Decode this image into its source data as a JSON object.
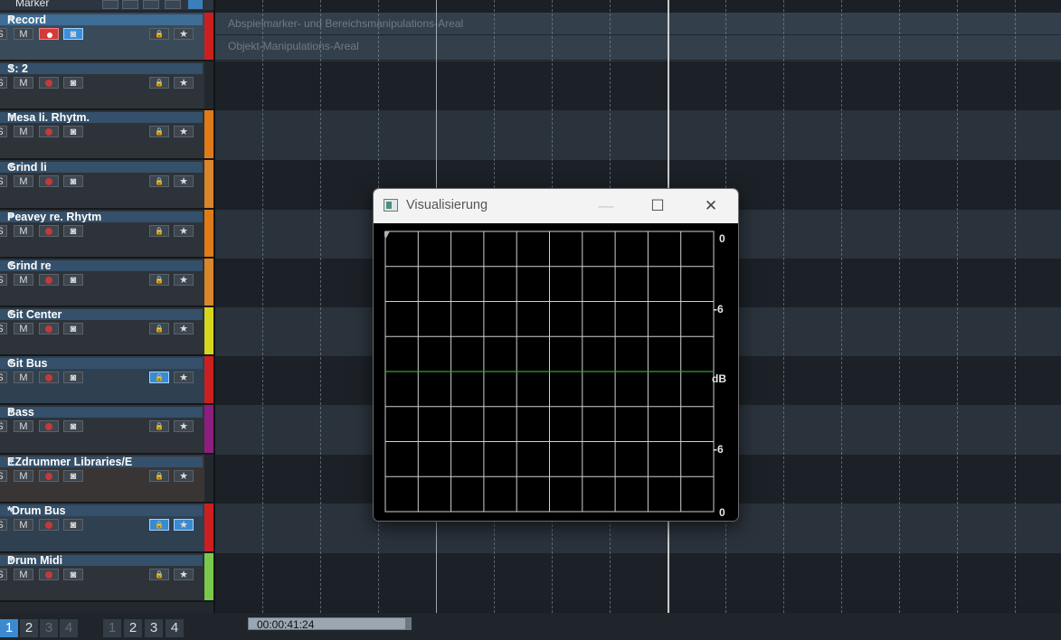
{
  "marker_header": {
    "label": "Marker"
  },
  "tracks": [
    {
      "name": "Record",
      "selected": true,
      "color": "#cc1f1f",
      "lock_on": false,
      "star_on": false
    },
    {
      "name": "S: 2",
      "selected": false,
      "color": "",
      "lock_on": false,
      "star_on": false
    },
    {
      "name": "Mesa li. Rhytm.",
      "selected": false,
      "color": "#e07b18",
      "lock_on": false,
      "star_on": false
    },
    {
      "name": "Grind li",
      "selected": false,
      "color": "#d9852a",
      "lock_on": false,
      "star_on": false
    },
    {
      "name": "Peavey re. Rhytm",
      "selected": false,
      "color": "#e07b18",
      "lock_on": false,
      "star_on": false
    },
    {
      "name": "Grind re",
      "selected": false,
      "color": "#d9852a",
      "lock_on": false,
      "star_on": false
    },
    {
      "name": "Git Center",
      "selected": false,
      "color": "#d6d61e",
      "lock_on": false,
      "star_on": false
    },
    {
      "name": "Git Bus",
      "selected": false,
      "color": "#cc1f1f",
      "lock_on": true,
      "star_on": false
    },
    {
      "name": "Bass",
      "selected": false,
      "color": "#8e1e7e",
      "lock_on": false,
      "star_on": false
    },
    {
      "name": "EZdrummer Libraries/E",
      "selected": false,
      "color": "",
      "lock_on": false,
      "star_on": false
    },
    {
      "name": "*Drum Bus",
      "selected": false,
      "color": "#cc1f1f",
      "lock_on": true,
      "star_on": true
    },
    {
      "name": "Drum Midi",
      "selected": false,
      "color": "#7ac94a",
      "lock_on": false,
      "star_on": false
    }
  ],
  "track_buttons": {
    "solo": "S",
    "mute": "M"
  },
  "arrange": {
    "area_rows": [
      "Abspielmarker- und Bereichsmanipulations-Areal",
      "Objekt-Manipulations-Areal"
    ]
  },
  "bottom_bar": {
    "pages_a": [
      "1",
      "2",
      "3",
      "4"
    ],
    "pages_a_active": "1",
    "pages_b": [
      "1",
      "2",
      "3",
      "4"
    ],
    "time": "00:00:41:24"
  },
  "dialog": {
    "title": "Visualisierung",
    "minimize": "—",
    "maximize": "☐",
    "close": "✕",
    "y_labels": [
      "0",
      "-6",
      "dB",
      "-6",
      "0"
    ],
    "trace_color": "#2fa32f",
    "grid_color": "#cfcfcf"
  }
}
